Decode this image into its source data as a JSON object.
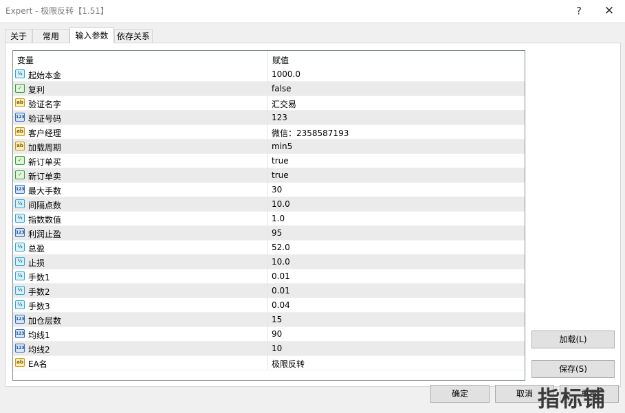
{
  "window": {
    "title": "Expert - 极限反转【1.51】",
    "help_glyph": "?",
    "close_glyph": "✕"
  },
  "tabs": [
    {
      "label": "关于"
    },
    {
      "label": "常用"
    },
    {
      "label": "输入参数",
      "active": true
    },
    {
      "label": "依存关系"
    }
  ],
  "grid": {
    "col_variable": "变量",
    "col_value": "赋值",
    "rows": [
      {
        "type": "double",
        "name": "起始本金",
        "value": "1000.0"
      },
      {
        "type": "bool",
        "name": "复利",
        "value": "false"
      },
      {
        "type": "string",
        "name": "验证名字",
        "value": "汇交易"
      },
      {
        "type": "int",
        "name": "验证号码",
        "value": "123"
      },
      {
        "type": "string",
        "name": "客户经理",
        "value": "微信：2358587193"
      },
      {
        "type": "string",
        "name": "加载周期",
        "value": "min5"
      },
      {
        "type": "bool",
        "name": "新订单买",
        "value": "true"
      },
      {
        "type": "bool",
        "name": "新订单卖",
        "value": "true"
      },
      {
        "type": "int",
        "name": "最大手数",
        "value": "30"
      },
      {
        "type": "double",
        "name": "间隔点数",
        "value": "10.0"
      },
      {
        "type": "double",
        "name": "指数数值",
        "value": "1.0"
      },
      {
        "type": "int",
        "name": "利润止盈",
        "value": "95"
      },
      {
        "type": "double",
        "name": "总盈",
        "value": "52.0"
      },
      {
        "type": "double",
        "name": "止损",
        "value": "10.0"
      },
      {
        "type": "double",
        "name": "手数1",
        "value": "0.01"
      },
      {
        "type": "double",
        "name": "手数2",
        "value": "0.01"
      },
      {
        "type": "double",
        "name": "手数3",
        "value": "0.04"
      },
      {
        "type": "int",
        "name": "加仓层数",
        "value": "15"
      },
      {
        "type": "int",
        "name": "均线1",
        "value": "90"
      },
      {
        "type": "int",
        "name": "均线2",
        "value": "10"
      },
      {
        "type": "string",
        "name": "EA名",
        "value": "极限反转"
      }
    ]
  },
  "type_icons": {
    "double": "½",
    "int": "123",
    "string": "ab",
    "bool": "✓"
  },
  "buttons": {
    "load": "加载(L)",
    "save": "保存(S)",
    "ok": "确定",
    "cancel": "取消",
    "reset": "重置"
  },
  "watermark": "指标铺"
}
